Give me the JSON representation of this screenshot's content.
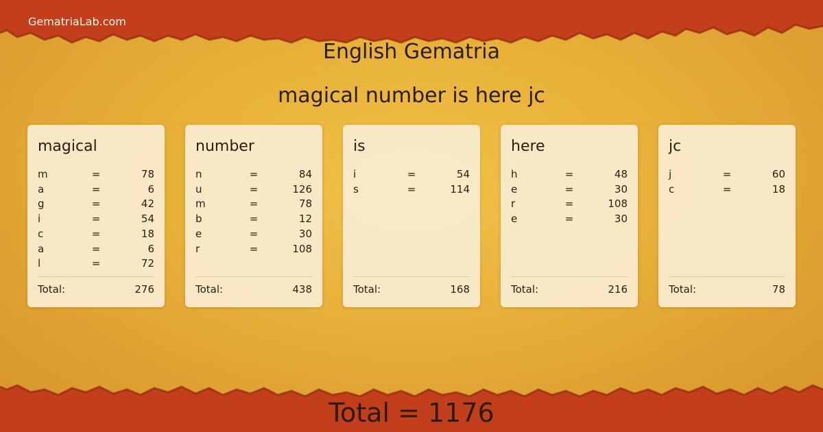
{
  "header": {
    "site_name": "GematriaLab.com",
    "title": "English Gematria",
    "phrase": "magical number is here jc"
  },
  "words": [
    {
      "word": "magical",
      "letters": [
        {
          "letter": "m",
          "eq": "=",
          "value": "78"
        },
        {
          "letter": "a",
          "eq": "=",
          "value": "6"
        },
        {
          "letter": "g",
          "eq": "=",
          "value": "42"
        },
        {
          "letter": "i",
          "eq": "=",
          "value": "54"
        },
        {
          "letter": "c",
          "eq": "=",
          "value": "18"
        },
        {
          "letter": "a",
          "eq": "=",
          "value": "6"
        },
        {
          "letter": "l",
          "eq": "=",
          "value": "72"
        }
      ],
      "total_label": "Total:",
      "total": "276"
    },
    {
      "word": "number",
      "letters": [
        {
          "letter": "n",
          "eq": "=",
          "value": "84"
        },
        {
          "letter": "u",
          "eq": "=",
          "value": "126"
        },
        {
          "letter": "m",
          "eq": "=",
          "value": "78"
        },
        {
          "letter": "b",
          "eq": "=",
          "value": "12"
        },
        {
          "letter": "e",
          "eq": "=",
          "value": "30"
        },
        {
          "letter": "r",
          "eq": "=",
          "value": "108"
        }
      ],
      "total_label": "Total:",
      "total": "438"
    },
    {
      "word": "is",
      "letters": [
        {
          "letter": "i",
          "eq": "=",
          "value": "54"
        },
        {
          "letter": "s",
          "eq": "=",
          "value": "114"
        }
      ],
      "total_label": "Total:",
      "total": "168"
    },
    {
      "word": "here",
      "letters": [
        {
          "letter": "h",
          "eq": "=",
          "value": "48"
        },
        {
          "letter": "e",
          "eq": "=",
          "value": "30"
        },
        {
          "letter": "r",
          "eq": "=",
          "value": "108"
        },
        {
          "letter": "e",
          "eq": "=",
          "value": "30"
        }
      ],
      "total_label": "Total:",
      "total": "216"
    },
    {
      "word": "jc",
      "letters": [
        {
          "letter": "j",
          "eq": "=",
          "value": "60"
        },
        {
          "letter": "c",
          "eq": "=",
          "value": "18"
        }
      ],
      "total_label": "Total:",
      "total": "78"
    }
  ],
  "footer": {
    "grand_total": "Total = 1176"
  },
  "colors": {
    "band": "#c33e1a",
    "band_dark": "#a93214",
    "background": "#e9b53a",
    "card": "#faecd0",
    "text": "#2a1c0e"
  }
}
